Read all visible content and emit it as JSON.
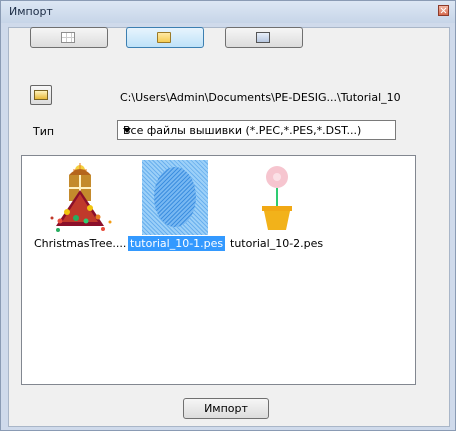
{
  "window": {
    "title": "Импорт"
  },
  "toolbar": {
    "buttons": [
      {
        "icon": "grid-view-icon",
        "active": false
      },
      {
        "icon": "folder-view-icon",
        "active": true
      },
      {
        "icon": "image-view-icon",
        "active": false
      }
    ]
  },
  "folder": {
    "open_icon": "open-folder-icon",
    "path": "C:\\Users\\Admin\\Documents\\PE-DESIG...\\Tutorial_10"
  },
  "filetype": {
    "label": "Тип",
    "selected": "Все файлы вышивки (*.PEC,*.PES,*.DST...)"
  },
  "files": [
    {
      "name": "ChristmasTree....",
      "selected": false,
      "thumb": "christmas-tree-thumbnail"
    },
    {
      "name": "tutorial_10-1.pes",
      "selected": true,
      "thumb": "oval-frame-thumbnail"
    },
    {
      "name": "tutorial_10-2.pes",
      "selected": false,
      "thumb": "flower-pot-thumbnail"
    }
  ],
  "actions": {
    "import_label": "Импорт"
  },
  "colors": {
    "selection": "#3399ff",
    "frame": "#cfdaeb"
  }
}
